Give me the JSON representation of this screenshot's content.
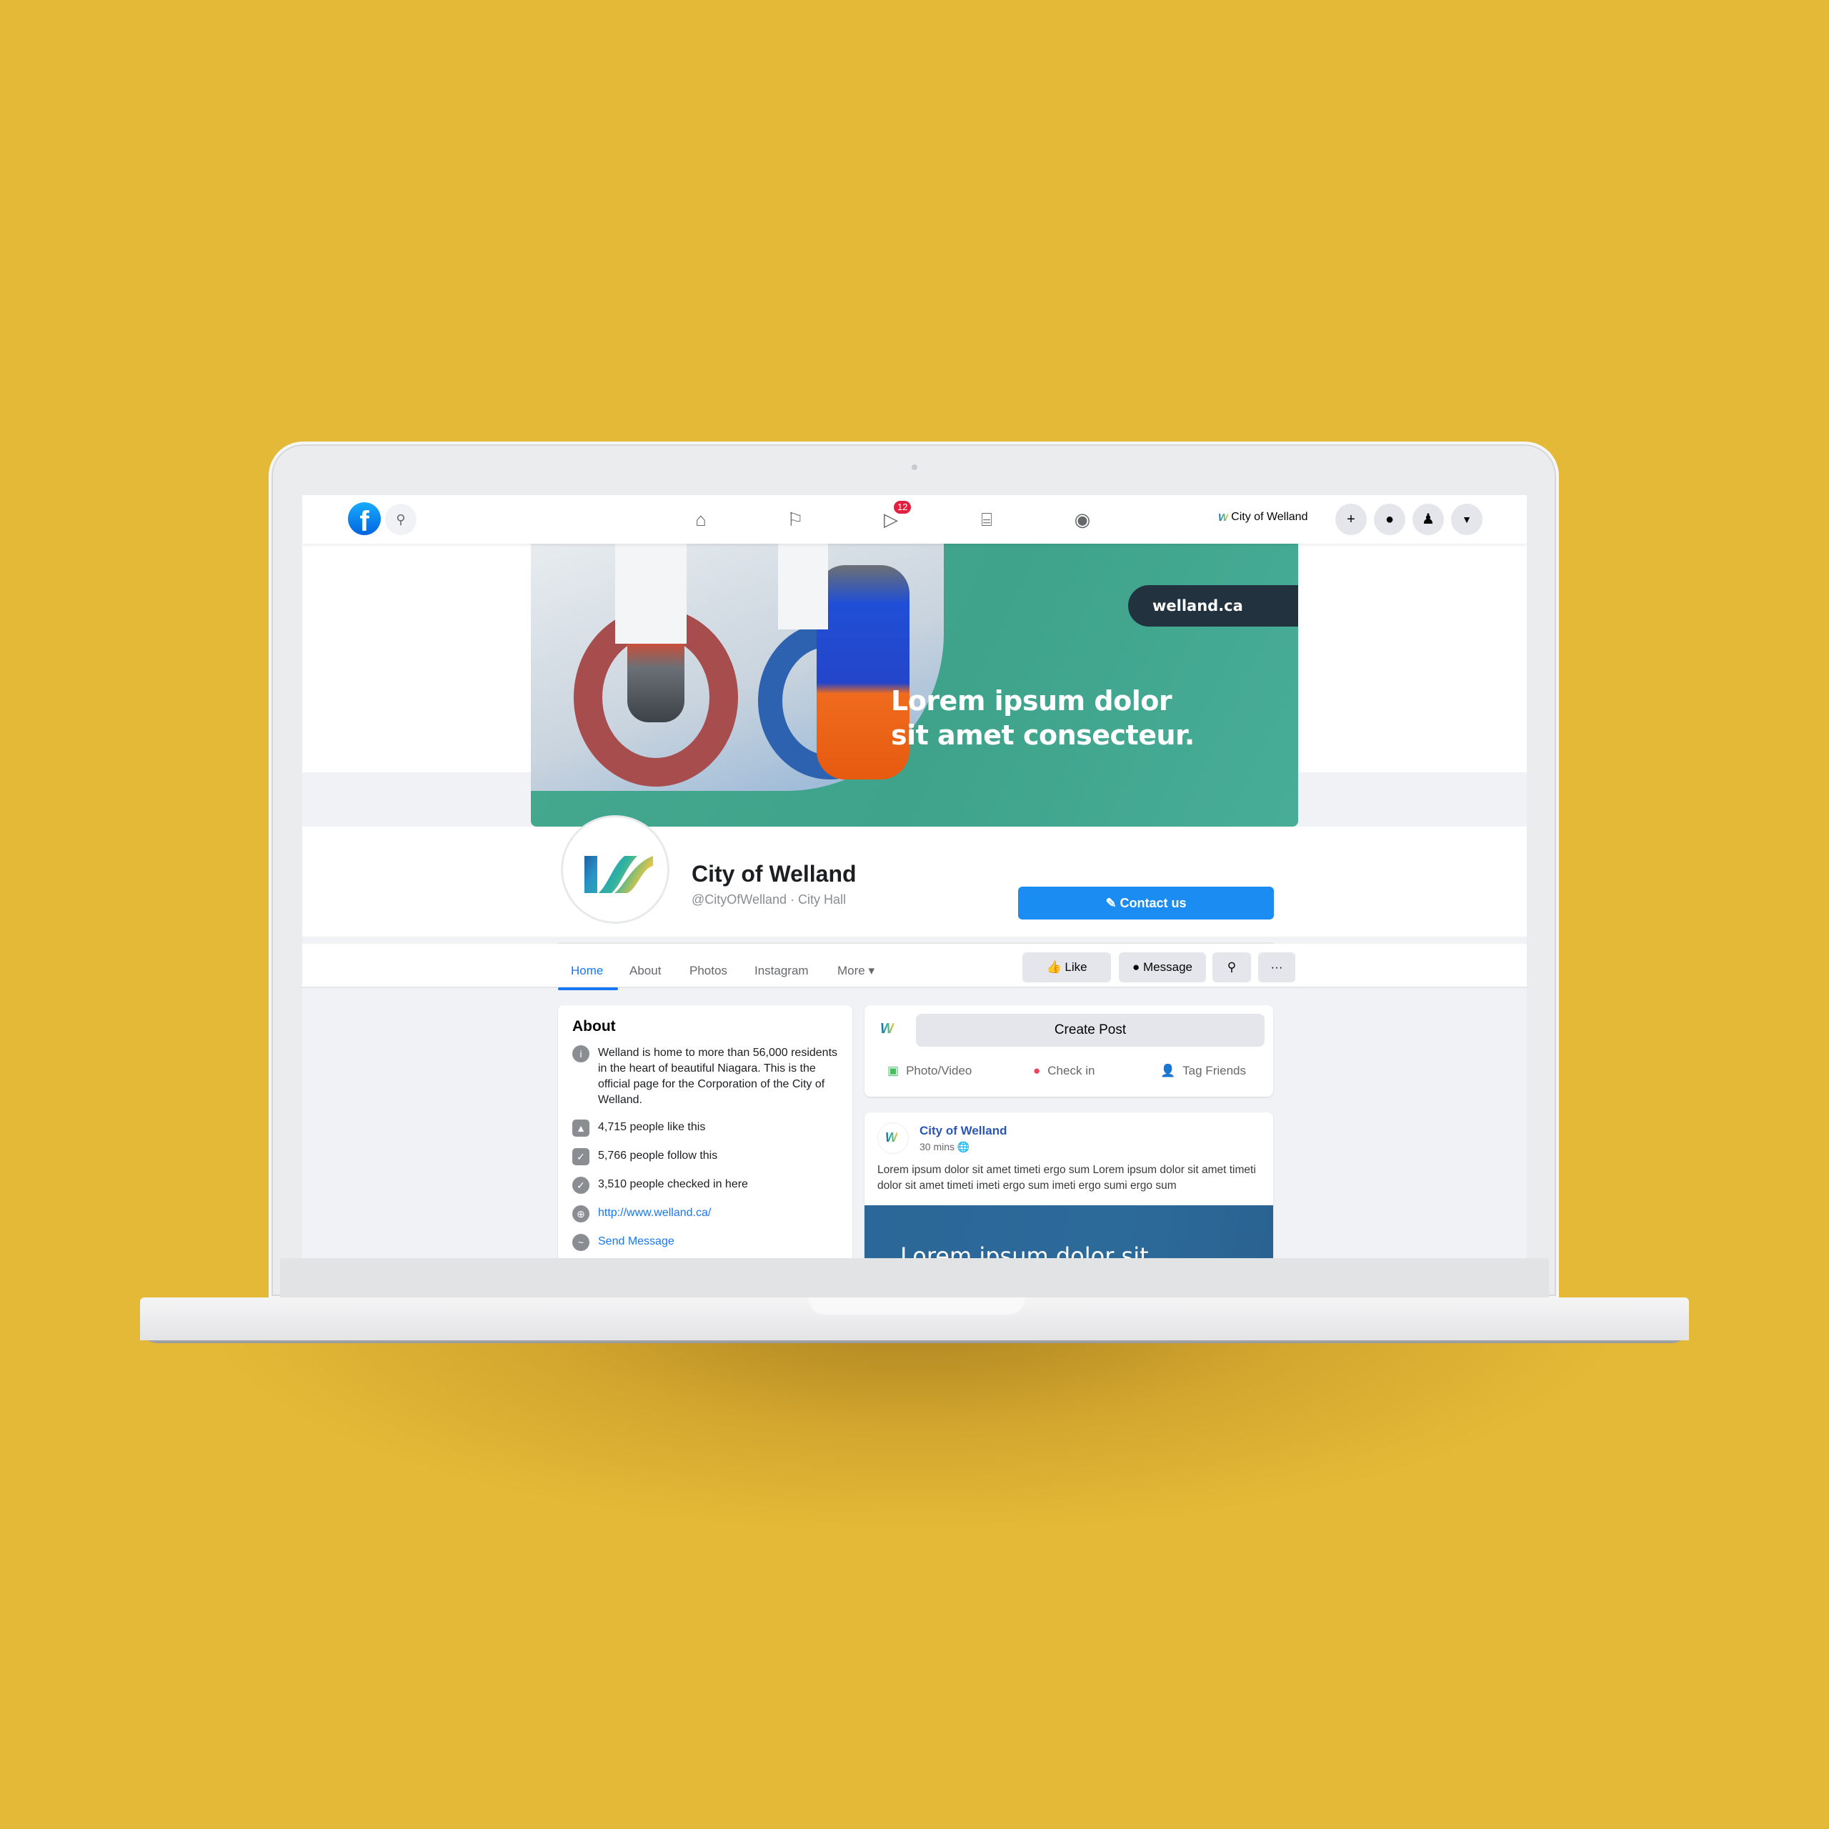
{
  "topbar": {
    "notification_count": "12",
    "page_switcher_label": "City of Welland",
    "page_switcher_logo": "W",
    "icons": [
      "facebook-logo",
      "search-icon",
      "home-icon",
      "flag-icon",
      "watch-icon",
      "marketplace-icon",
      "groups-icon",
      "plus-icon",
      "messenger-icon",
      "bell-icon",
      "caret-down-icon"
    ]
  },
  "cover": {
    "pill_text": "welland.ca",
    "headline_line1": "Lorem ipsum dolor",
    "headline_line2": "sit amet consecteur."
  },
  "profile": {
    "name": "City of Welland",
    "handle": "@CityOfWelland",
    "category": "· City Hall",
    "contact_button": "Contact us"
  },
  "tabs": [
    {
      "label": "Home",
      "active": true
    },
    {
      "label": "About"
    },
    {
      "label": "Photos"
    },
    {
      "label": "Instagram"
    },
    {
      "label": "More ▾"
    }
  ],
  "actions": {
    "like": "Like",
    "message": "Message"
  },
  "about": {
    "title": "About",
    "description": "Welland is home to more than 56,000 residents in the heart of beautiful Niagara. This is the official page for the Corporation of the City of Welland.",
    "likes": "4,715 people like this",
    "follows": "5,766 people follow this",
    "checkins": "3,510 people checked in here",
    "website": "http://www.welland.ca/",
    "send_message": "Send Message"
  },
  "composer": {
    "create_post": "Create Post",
    "photo_video": "Photo/Video",
    "check_in": "Check in",
    "tag_friends": "Tag Friends"
  },
  "post": {
    "author": "City of Welland",
    "time": "30 mins",
    "text": "Lorem ipsum dolor sit amet timeti ergo sum Lorem ipsum dolor sit amet timeti dolor sit amet timeti imeti ergo sum imeti ergo sumi ergo sum",
    "image_text": "Lorem ipsum dolor sit"
  },
  "colors": {
    "background": "#E4B937",
    "facebook_blue": "#1877F2",
    "cover_green": "#46AB93",
    "pill_dark": "#22333F",
    "post_image_blue": "#2B6798"
  }
}
